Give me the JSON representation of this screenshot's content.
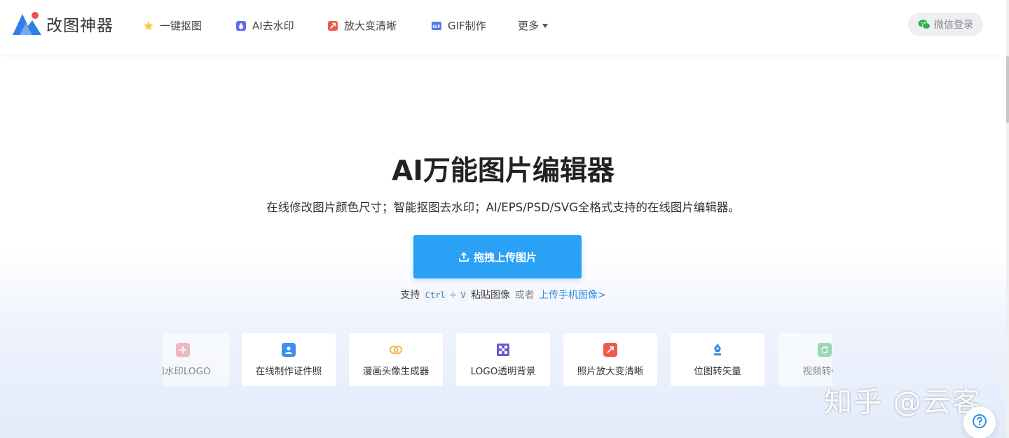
{
  "brand": {
    "name": "改图神器"
  },
  "nav": {
    "items": [
      {
        "label": "一键抠图",
        "icon": "star-icon"
      },
      {
        "label": "AI去水印",
        "icon": "droplet-icon"
      },
      {
        "label": "放大变清晰",
        "icon": "enlarge-icon"
      },
      {
        "label": "GIF制作",
        "icon": "gif-icon"
      },
      {
        "label": "更多",
        "icon": "chevron-down-icon"
      }
    ],
    "login_label": "微信登录"
  },
  "hero": {
    "title": "AI万能图片编辑器",
    "subtitle": "在线修改图片颜色尺寸；智能抠图去水印；AI/EPS/PSD/SVG全格式支持的在线图片编辑器。",
    "upload_label": "拖拽上传图片",
    "paste_prefix": "支持",
    "key_ctrl": "Ctrl",
    "key_plus": "+",
    "key_v": "V",
    "paste_suffix": "粘贴图像",
    "or_text": "或者",
    "mobile_link": "上传手机图像>"
  },
  "tools": [
    {
      "label": "加水印LOGO",
      "icon": "plus-icon",
      "color": "#f08a8a"
    },
    {
      "label": "在线制作证件照",
      "icon": "id-photo-icon",
      "color": "#3d8ef0"
    },
    {
      "label": "漫画头像生成器",
      "icon": "cartoon-avatar-icon",
      "color": "#f2b84b"
    },
    {
      "label": "LOGO透明背景",
      "icon": "checkerboard-icon",
      "color": "#6a5acd"
    },
    {
      "label": "照片放大变清晰",
      "icon": "enlarge-icon",
      "color": "#f05a4a"
    },
    {
      "label": "位图转矢量",
      "icon": "pen-nib-icon",
      "color": "#2f8fe0"
    },
    {
      "label": "视频转GIF",
      "icon": "video-gif-icon",
      "color": "#5cc27a"
    }
  ],
  "watermark": "知乎 @云客",
  "colors": {
    "primary": "#2ba1f6",
    "link": "#2f8fe0",
    "logo_blue": "#2f7fe8",
    "logo_red": "#f04d4d"
  }
}
